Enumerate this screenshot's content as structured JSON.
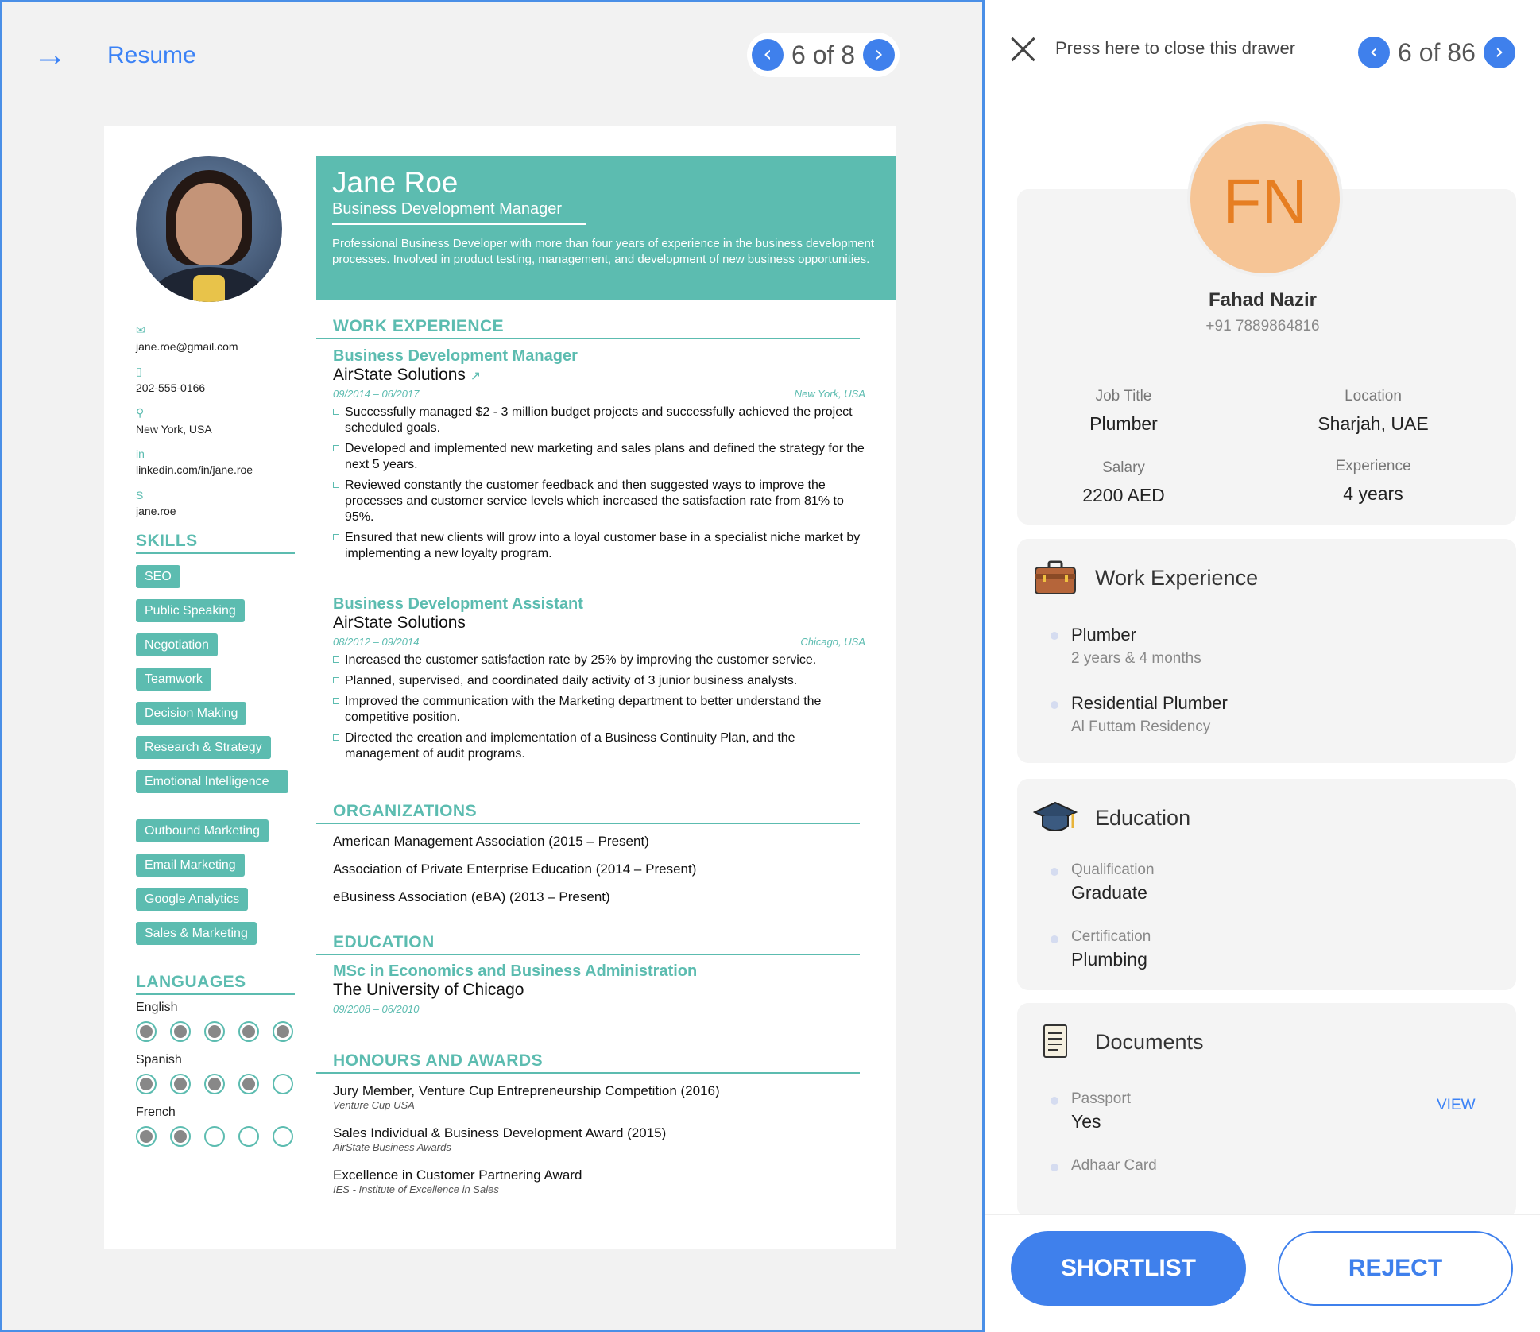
{
  "left_panel": {
    "title": "Resume",
    "pager": {
      "text": "6 of 8",
      "prev": "‹",
      "next": "›"
    }
  },
  "resume": {
    "name": "Jane Roe",
    "title": "Business Development Manager",
    "summary": "Professional Business Developer with more than four years of experience in the business development processes. Involved in product testing, management, and development of new business opportunities.",
    "contacts": [
      {
        "icon": "email-icon",
        "glyph": "✉",
        "text": "jane.roe@gmail.com"
      },
      {
        "icon": "phone-icon",
        "glyph": "▯",
        "text": "202-555-0166"
      },
      {
        "icon": "location-icon",
        "glyph": "⚲",
        "text": "New York, USA"
      },
      {
        "icon": "linkedin-icon",
        "glyph": "in",
        "text": "linkedin.com/in/jane.roe"
      },
      {
        "icon": "skype-icon",
        "glyph": "S",
        "text": "jane.roe"
      }
    ],
    "skills_heading": "SKILLS",
    "skills": [
      "SEO",
      "Public Speaking",
      "Negotiation",
      "Teamwork",
      "Decision Making",
      "Research & Strategy",
      "Emotional Intelligence",
      "Outbound Marketing",
      "Email Marketing",
      "Google Analytics",
      "Sales & Marketing"
    ],
    "languages_heading": "LANGUAGES",
    "languages": [
      {
        "name": "English",
        "level": 5
      },
      {
        "name": "Spanish",
        "level": 4
      },
      {
        "name": "French",
        "level": 2
      }
    ],
    "work_heading": "WORK EXPERIENCE",
    "jobs": [
      {
        "role": "Business Development Manager",
        "company": "AirState Solutions",
        "link_icon": "↗",
        "dates": "09/2014 – 06/2017",
        "place": "New York, USA",
        "bullets": [
          "Successfully managed $2 - 3 million budget projects and successfully achieved the project scheduled goals.",
          "Developed and implemented new marketing and sales plans and defined the strategy for the next 5 years.",
          "Reviewed constantly the customer feedback and then suggested ways to improve the processes and customer service levels which increased the satisfaction rate from 81% to 95%.",
          "Ensured that new clients will grow into a loyal customer base in a specialist niche market by implementing a new loyalty program."
        ]
      },
      {
        "role": "Business Development Assistant",
        "company": "AirState Solutions",
        "dates": "08/2012 – 09/2014",
        "place": "Chicago, USA",
        "bullets": [
          "Increased the customer satisfaction rate by 25% by improving the customer service.",
          "Planned, supervised, and coordinated daily activity of 3 junior business analysts.",
          "Improved the communication with the Marketing department to better understand the competitive position.",
          "Directed the creation and implementation of a Business Continuity Plan, and the management of audit programs."
        ]
      }
    ],
    "org_heading": "ORGANIZATIONS",
    "organizations": [
      "American Management Association (2015 – Present)",
      "Association of Private Enterprise Education (2014 – Present)",
      "eBusiness Association (eBA) (2013 – Present)"
    ],
    "edu_heading": "EDUCATION",
    "education": {
      "degree": "MSc in Economics and Business Administration",
      "school": "The University of Chicago",
      "dates": "09/2008 – 06/2010"
    },
    "awards_heading": "HONOURS AND AWARDS",
    "awards": [
      {
        "title": "Jury Member, Venture Cup Entrepreneurship Competition (2016)",
        "org": "Venture Cup USA"
      },
      {
        "title": "Sales Individual & Business Development Award (2015)",
        "org": "AirState Business Awards"
      },
      {
        "title": "Excellence in Customer Partnering Award",
        "org": "IES - Institute of Excellence in Sales"
      }
    ]
  },
  "drawer": {
    "close_text": "Press here to close this drawer",
    "pager": {
      "text": "6 of 86",
      "prev": "‹",
      "next": "›"
    },
    "initials": "FN",
    "name": "Fahad Nazir",
    "phone": "+91 7889864816",
    "job_title_label": "Job Title",
    "job_title": "Plumber",
    "location_label": "Location",
    "location": "Sharjah, UAE",
    "salary_label": "Salary",
    "salary": "2200 AED",
    "experience_label": "Experience",
    "experience": "4 years",
    "work_title": "Work Experience",
    "work_items": [
      {
        "title": "Plumber",
        "sub": "2 years & 4 months"
      },
      {
        "title": "Residential Plumber",
        "sub": "Al Futtam Residency"
      }
    ],
    "edu_title": "Education",
    "edu_items": [
      {
        "label": "Qualification",
        "value": "Graduate"
      },
      {
        "label": "Certification",
        "value": "Plumbing"
      }
    ],
    "docs_title": "Documents",
    "doc_items": [
      {
        "label": "Passport",
        "value": "Yes"
      },
      {
        "label": "Adhaar Card",
        "value": ""
      }
    ],
    "view_label": "VIEW",
    "shortlist_label": "SHORTLIST",
    "reject_label": "REJECT"
  },
  "colors": {
    "accent": "#3f80ec",
    "teal": "#5cbcb0",
    "avatar_bg": "#f6c596",
    "avatar_text": "#e67e22"
  }
}
